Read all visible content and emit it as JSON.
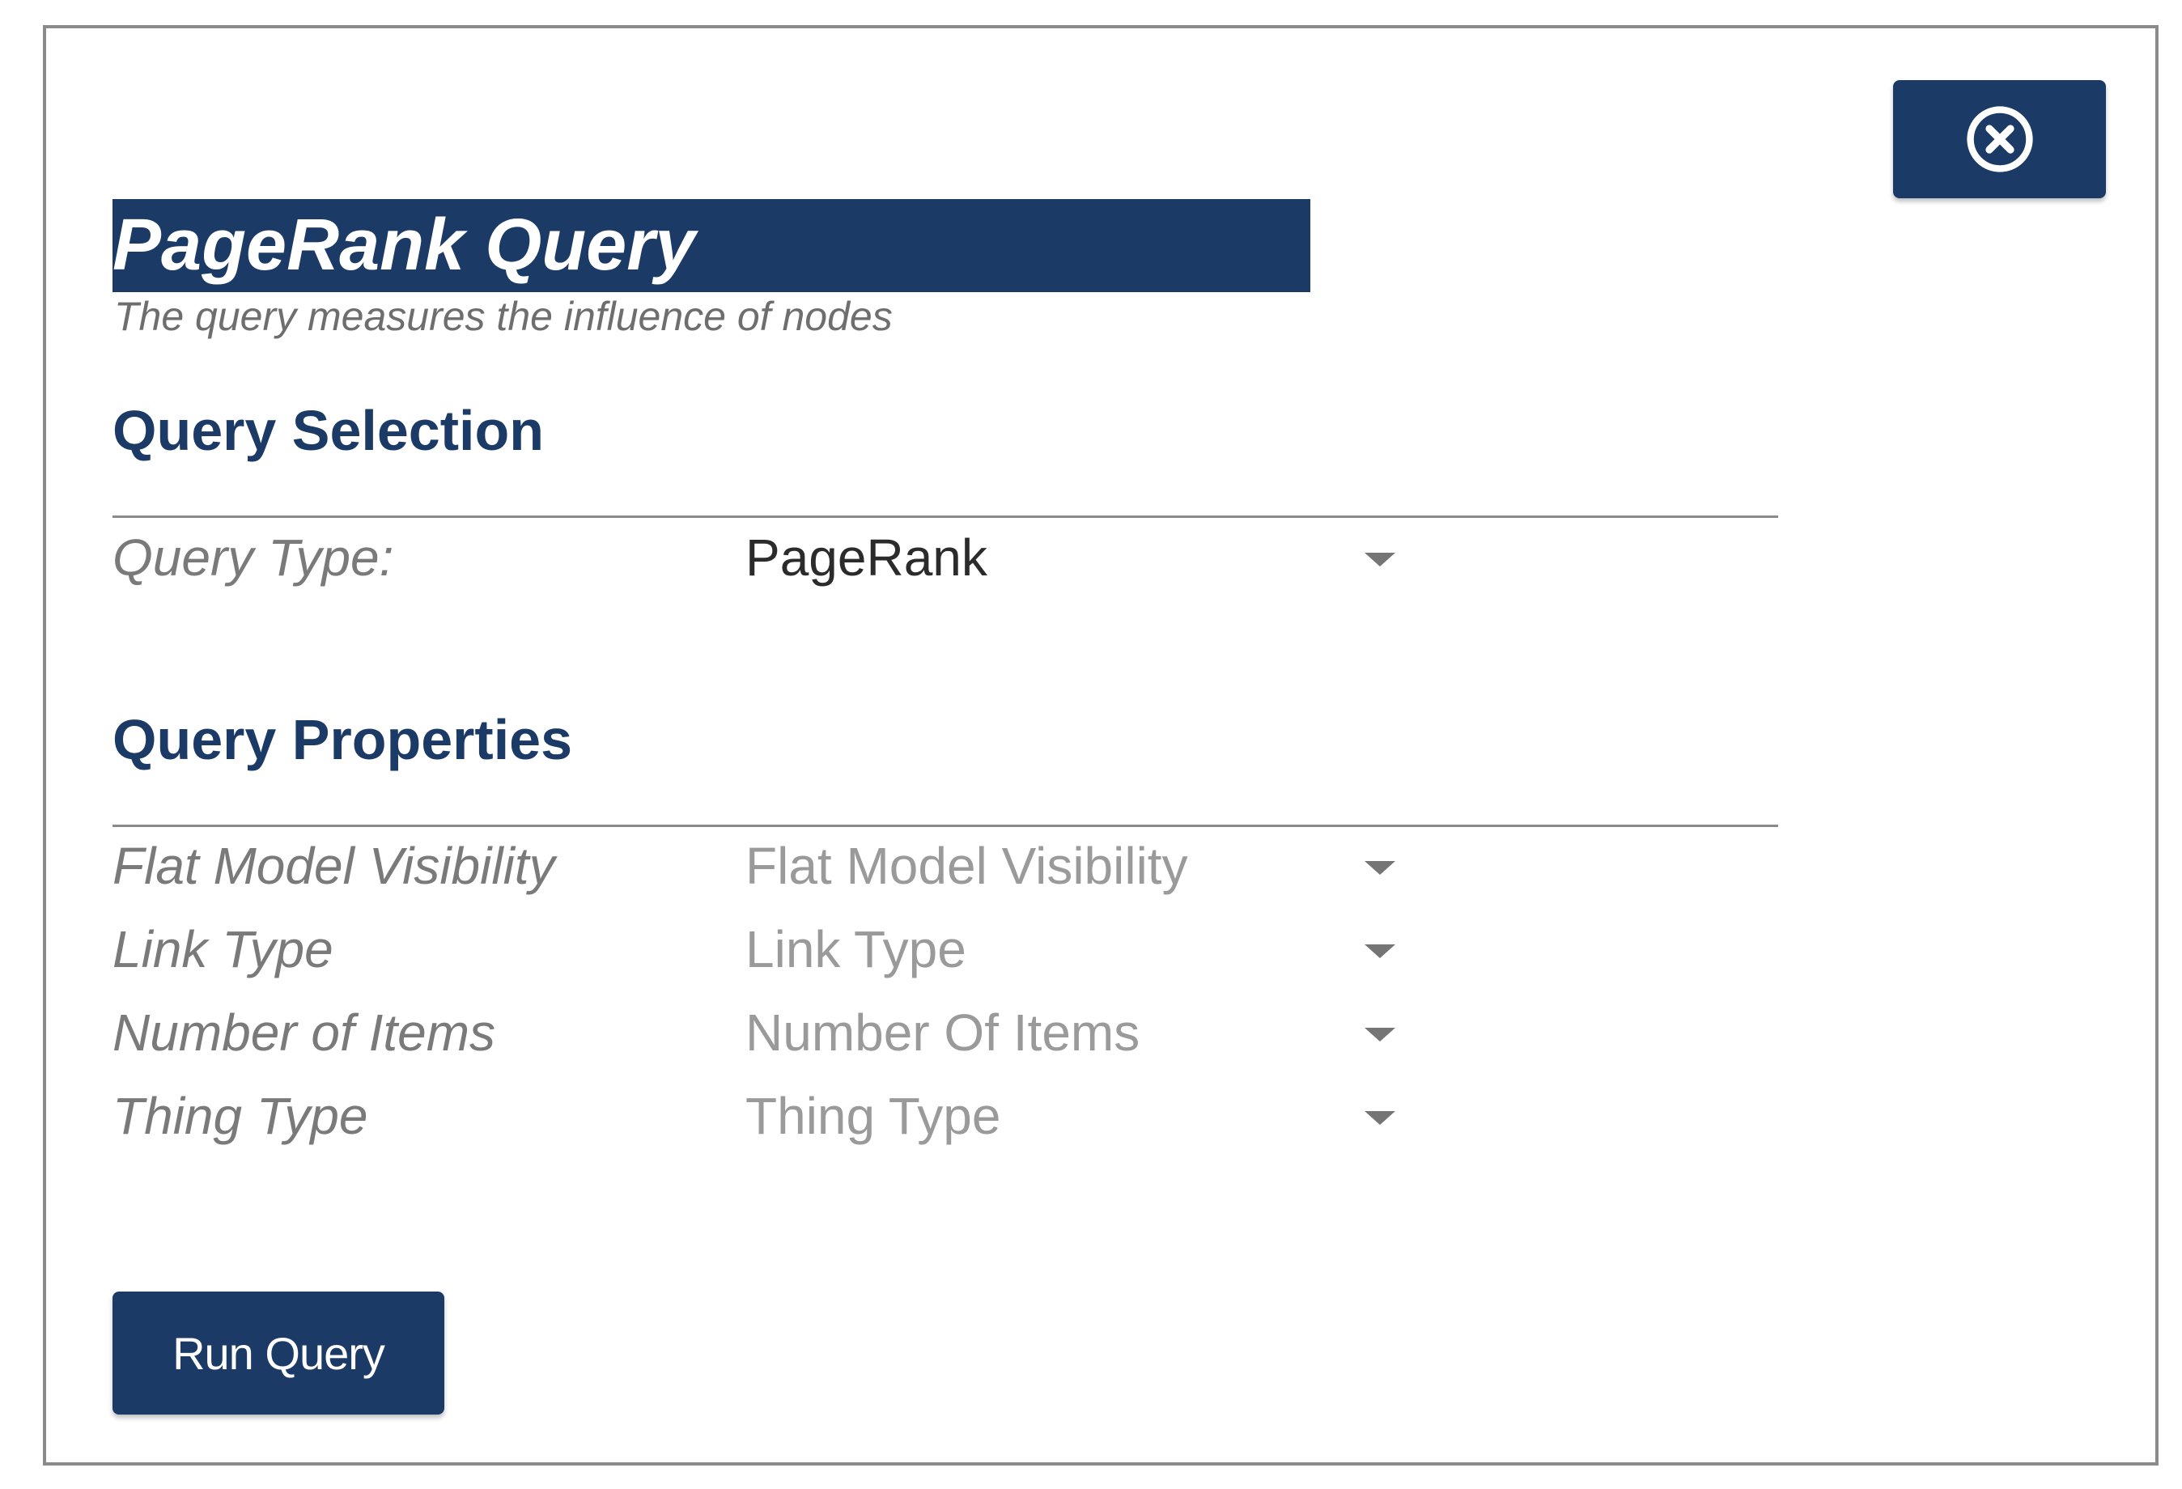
{
  "dialog": {
    "title": "PageRank Query",
    "subtitle": "The query measures the influence of nodes",
    "close_icon": "close-circle-icon"
  },
  "query_selection": {
    "heading": "Query Selection",
    "query_type": {
      "label": "Query Type:",
      "value": "PageRank"
    }
  },
  "query_properties": {
    "heading": "Query Properties",
    "fields": [
      {
        "label": "Flat Model Visibility",
        "placeholder": "Flat Model Visibility"
      },
      {
        "label": "Link Type",
        "placeholder": "Link Type"
      },
      {
        "label": "Number of Items",
        "placeholder": "Number Of Items"
      },
      {
        "label": "Thing Type",
        "placeholder": "Thing Type"
      }
    ]
  },
  "actions": {
    "run_label": "Run Query"
  },
  "colors": {
    "primary": "#1c3a66",
    "border": "#8a8a8a",
    "label_text": "#7a7a7a",
    "placeholder_text": "#9a9a9a"
  }
}
